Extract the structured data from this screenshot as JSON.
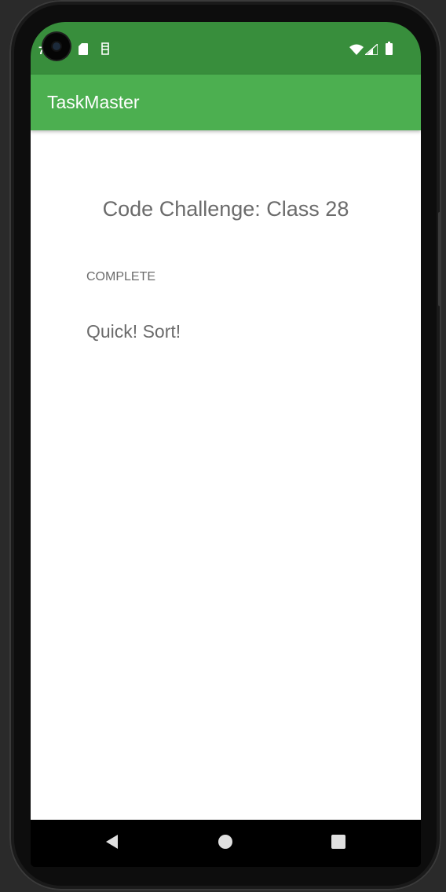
{
  "status_bar": {
    "left_glyph": "7",
    "icons": [
      "sd-card-icon",
      "sim-icon",
      "wifi-icon",
      "cell-signal-icon",
      "battery-icon"
    ],
    "color": "#388e3c"
  },
  "app_bar": {
    "title": "TaskMaster",
    "color": "#4caf50"
  },
  "task": {
    "title": "Code Challenge: Class 28",
    "state": "COMPLETE",
    "body": "Quick! Sort!"
  },
  "nav_bar": {
    "buttons": [
      "back-icon",
      "home-icon",
      "recents-icon"
    ]
  }
}
